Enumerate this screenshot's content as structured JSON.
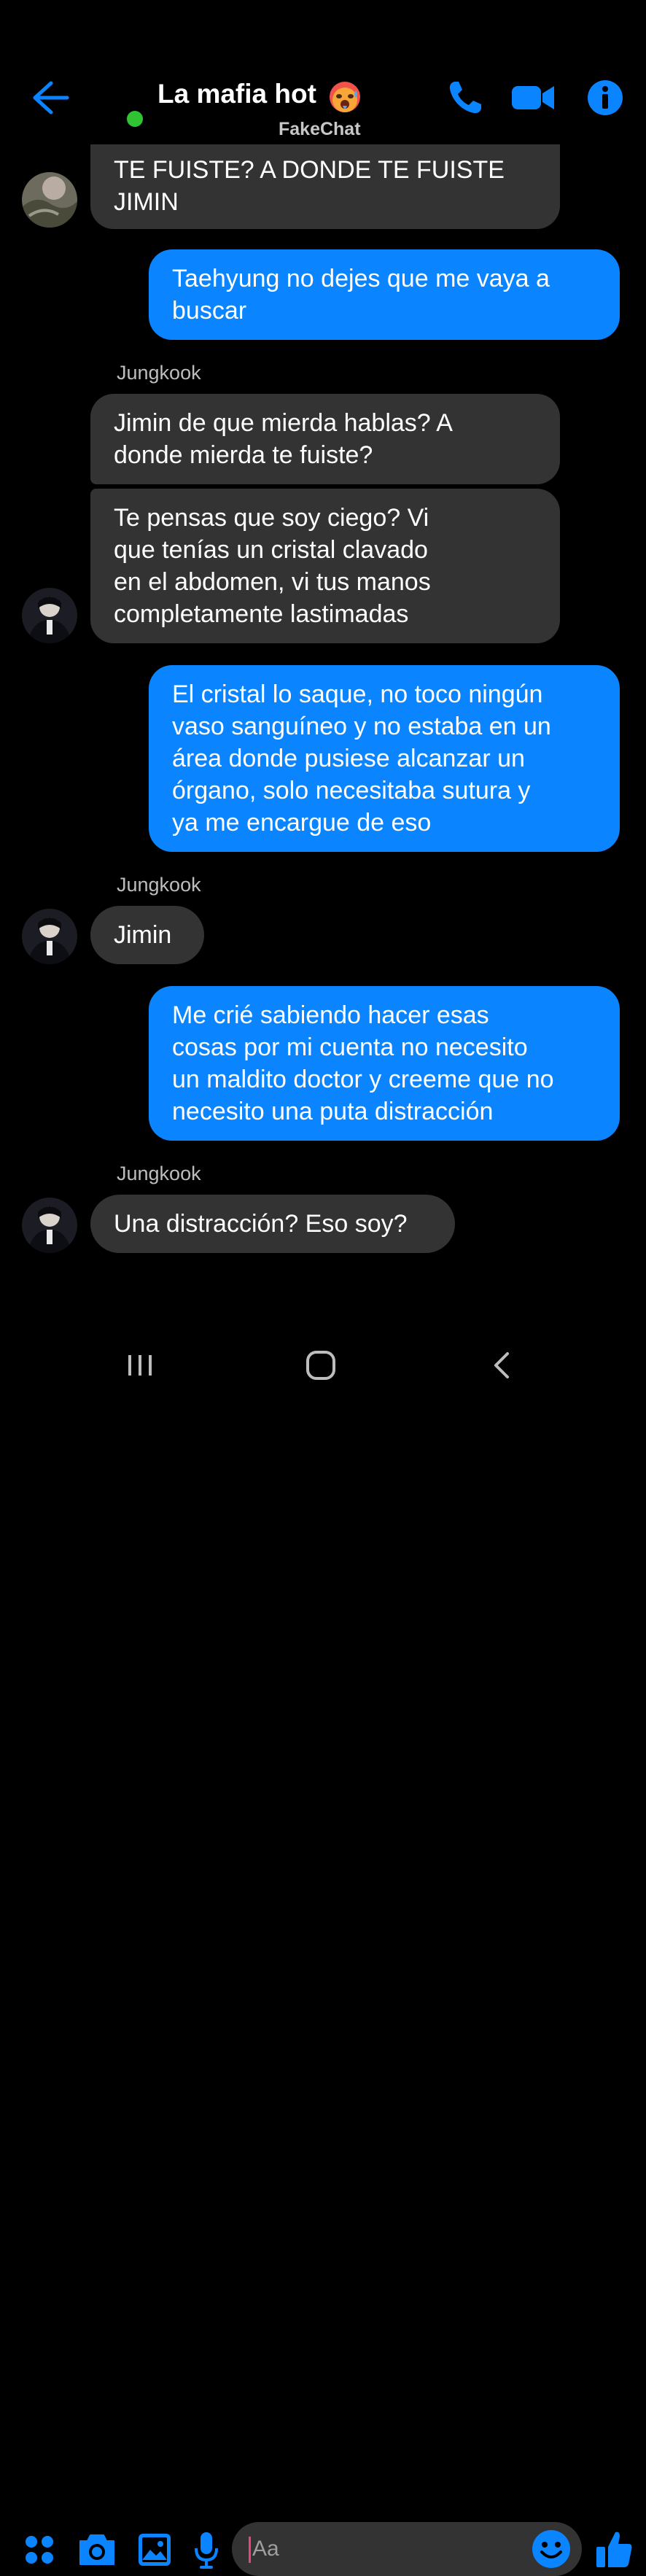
{
  "header": {
    "title": "La mafia hot",
    "watermark": "FakeChat"
  },
  "colors": {
    "accent": "#0a84ff",
    "incoming_bubble": "#333333",
    "online": "#31c432",
    "background": "#000000"
  },
  "messages": [
    {
      "type": "in",
      "text": "TE FUISTE? A DONDE TE FUISTE\nJIMIN"
    },
    {
      "type": "out",
      "text": "Taehyung no dejes que me vaya a\nbuscar"
    },
    {
      "type": "sender",
      "text": "Jungkook"
    },
    {
      "type": "in",
      "text": "Jimin de que mierda hablas? A\ndonde mierda te fuiste?"
    },
    {
      "type": "in",
      "text": "Te pensas que soy ciego? Vi\nque tenías un cristal clavado\nen el abdomen, vi tus manos\ncompletamente lastimadas"
    },
    {
      "type": "out",
      "text": "El cristal lo saque, no toco ningún\nvaso sanguíneo y no estaba en un\nárea donde pusiese alcanzar un\nórgano, solo necesitaba sutura y\nya me encargue de eso"
    },
    {
      "type": "sender",
      "text": "Jungkook"
    },
    {
      "type": "in",
      "text": "Jimin"
    },
    {
      "type": "out",
      "text": "Me crié sabiendo hacer esas\ncosas por mi cuenta no necesito\nun maldito doctor y creeme que no\nnecesito una puta distracción"
    },
    {
      "type": "sender",
      "text": "Jungkook"
    },
    {
      "type": "in",
      "text": "Una distracción? Eso soy?"
    }
  ],
  "composer": {
    "placeholder": "Aa"
  },
  "icons": {
    "back": "arrow-left",
    "call": "phone",
    "video": "video-camera",
    "info": "info-circle",
    "apps": "four-dots",
    "camera": "camera",
    "gallery": "image",
    "mic": "microphone",
    "emoji": "smiley",
    "like": "thumbs-up"
  }
}
